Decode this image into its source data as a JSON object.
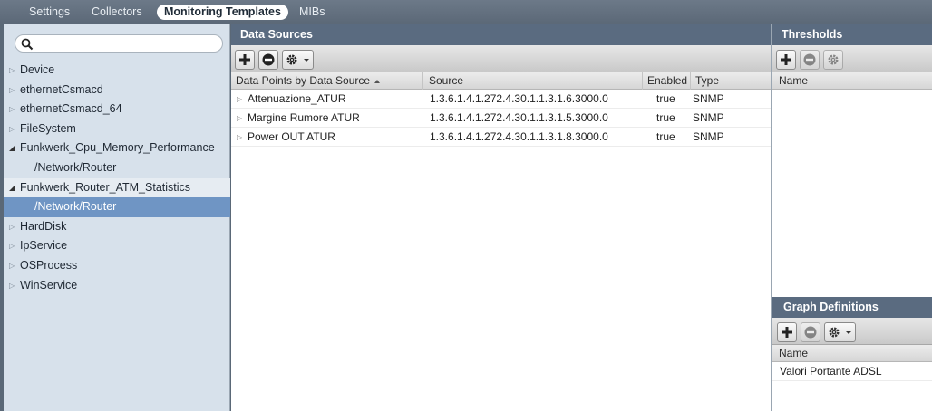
{
  "nav": {
    "tabs": [
      {
        "label": "Settings"
      },
      {
        "label": "Collectors"
      },
      {
        "label": "Monitoring Templates",
        "active": true
      },
      {
        "label": "MIBs"
      }
    ]
  },
  "tree": {
    "search_placeholder": "",
    "items": [
      {
        "label": "Device",
        "level": 0,
        "expanded": false
      },
      {
        "label": "ethernetCsmacd",
        "level": 0,
        "expanded": false
      },
      {
        "label": "ethernetCsmacd_64",
        "level": 0,
        "expanded": false
      },
      {
        "label": "FileSystem",
        "level": 0,
        "expanded": false
      },
      {
        "label": "Funkwerk_Cpu_Memory_Performance",
        "level": 0,
        "expanded": true
      },
      {
        "label": "/Network/Router",
        "level": 1
      },
      {
        "label": "Funkwerk_Router_ATM_Statistics",
        "level": 0,
        "expanded": true,
        "highlighted": true
      },
      {
        "label": "/Network/Router",
        "level": 1,
        "selected": true
      },
      {
        "label": "HardDisk",
        "level": 0,
        "expanded": false
      },
      {
        "label": "IpService",
        "level": 0,
        "expanded": false
      },
      {
        "label": "OSProcess",
        "level": 0,
        "expanded": false
      },
      {
        "label": "WinService",
        "level": 0,
        "expanded": false
      }
    ]
  },
  "datasources": {
    "title": "Data Sources",
    "columns": {
      "datapoints": "Data Points by Data Source",
      "source": "Source",
      "enabled": "Enabled",
      "type": "Type"
    },
    "sorted_column": "datapoints",
    "rows": [
      {
        "name": "Attenuazione_ATUR",
        "source": "1.3.6.1.4.1.272.4.30.1.1.3.1.6.3000.0",
        "enabled": "true",
        "type": "SNMP"
      },
      {
        "name": "Margine Rumore ATUR",
        "source": "1.3.6.1.4.1.272.4.30.1.1.3.1.5.3000.0",
        "enabled": "true",
        "type": "SNMP"
      },
      {
        "name": "Power OUT ATUR",
        "source": "1.3.6.1.4.1.272.4.30.1.1.3.1.8.3000.0",
        "enabled": "true",
        "type": "SNMP"
      }
    ]
  },
  "thresholds": {
    "title": "Thresholds",
    "name_header": "Name"
  },
  "graphs": {
    "title": "Graph Definitions",
    "name_header": "Name",
    "items": [
      {
        "name": "Valori Portante ADSL"
      }
    ]
  },
  "icons": {
    "add": "plus-icon",
    "delete": "minus-icon",
    "actions": "gear-icon",
    "search": "search-icon",
    "collapsed": "triangle-right-icon",
    "expanded": "triangle-down-icon"
  },
  "colors": {
    "nav_bg": "#5b6877",
    "tree_bg": "#d7e1eb",
    "selection": "#6f95c4",
    "panel_header": "#5a6b80"
  }
}
